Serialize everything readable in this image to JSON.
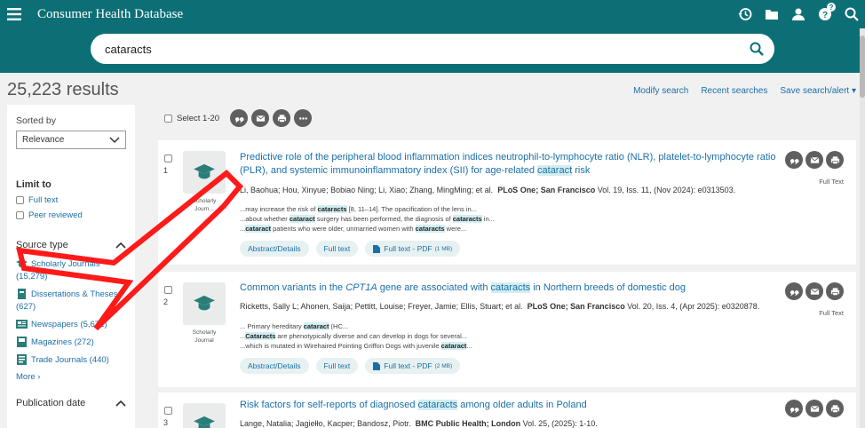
{
  "header": {
    "brand": "Consumer Health Database",
    "help_badge": "?"
  },
  "search": {
    "query": "cataracts"
  },
  "results": {
    "count": "25,223 results",
    "links": [
      "Modify search",
      "Recent searches",
      "Save search/alert ▾"
    ]
  },
  "sidebar": {
    "sorted_by": "Sorted by",
    "sort_value": "Relevance",
    "limit_to": "Limit to",
    "limit_options": [
      "Full text",
      "Peer reviewed"
    ],
    "source_type": "Source type",
    "sources": [
      {
        "label": "Scholarly Journals",
        "count": "(15,279)",
        "icon": "journal-cap-icon"
      },
      {
        "label": "Dissertations & Theses",
        "count": "(627)",
        "icon": "dissertation-icon"
      },
      {
        "label": "Newspapers (5,671)",
        "count": "",
        "icon": "newspaper-icon"
      },
      {
        "label": "Magazines (272)",
        "count": "",
        "icon": "magazine-icon"
      },
      {
        "label": "Trade Journals (440)",
        "count": "",
        "icon": "trade-journal-icon"
      }
    ],
    "more": "More ›",
    "publication_date": "Publication date"
  },
  "toolbar": {
    "select_label": "Select 1-20"
  },
  "items": [
    {
      "num": "1",
      "thumb_label": "Scholarly Journ...",
      "title_parts": [
        "Predictive role of the peripheral blood inflammation indices neutrophil-to-lymphocyte ratio (NLR), platelet-to-lymphocyte ratio (PLR), and systemic immunoinflammatory index (SII) for age-related ",
        "cataract",
        " risk"
      ],
      "authors": "Li, Baohua; Hou, Xinyue; Bobiao Ning; Li, Xiao; Zhang, MingMing; et al.",
      "source": "PLoS One; San Francisco",
      "citation": "Vol. 19, Iss. 11,  (Nov 2024): e0313503.",
      "snippets": [
        [
          "...may increase the risk of ",
          "cataracts",
          " [8, 11–14]. The opacification of the lens in..."
        ],
        [
          "...about whether ",
          "cataract",
          " surgery has been performed, the diagnosis of ",
          "cataracts",
          " in..."
        ],
        [
          "...",
          "cataract",
          " patients who were older, unmarried women with ",
          "cataracts",
          " were..."
        ]
      ],
      "actions": [
        "Abstract/Details",
        "Full text",
        "Full text - PDF"
      ],
      "pdf_size": "(1 MB)",
      "full_text_label": "Full Text"
    },
    {
      "num": "2",
      "thumb_label": "Scholarly Journal",
      "title_parts": [
        "Common variants in the ",
        "CPT1A",
        " gene are associated with ",
        "cataracts",
        " in Northern breeds of domestic dog"
      ],
      "authors": "Ricketts, Sally L; Ahonen, Saija; Pettitt, Louise; Freyer, Jamie; Ellis, Stuart; et al.",
      "source": "PLoS One; San Francisco",
      "citation": "Vol. 20, Iss. 4,  (Apr 2025): e0320878.",
      "snippets": [
        [
          "... Primary hereditary ",
          "cataract",
          " (HC..."
        ],
        [
          "...",
          "Cataracts",
          " are phenotypically diverse and can develop in dogs for several..."
        ],
        [
          "...which is mutated in Wirehaired Pointing Griffon Dogs with juvenile ",
          "cataract",
          "..."
        ]
      ],
      "actions": [
        "Abstract/Details",
        "Full text",
        "Full text - PDF"
      ],
      "pdf_size": "(2 MB)",
      "full_text_label": "Full Text"
    },
    {
      "num": "3",
      "title_parts": [
        "Risk factors for self-reports of diagnosed ",
        "cataracts",
        " among older adults in Poland"
      ],
      "authors": "Lange, Natalia; Jagiełło, Kacper; Bandosz, Piotr.",
      "source": "BMC Public Health; London",
      "citation": "Vol. 25,  (2025): 1-10."
    }
  ]
}
